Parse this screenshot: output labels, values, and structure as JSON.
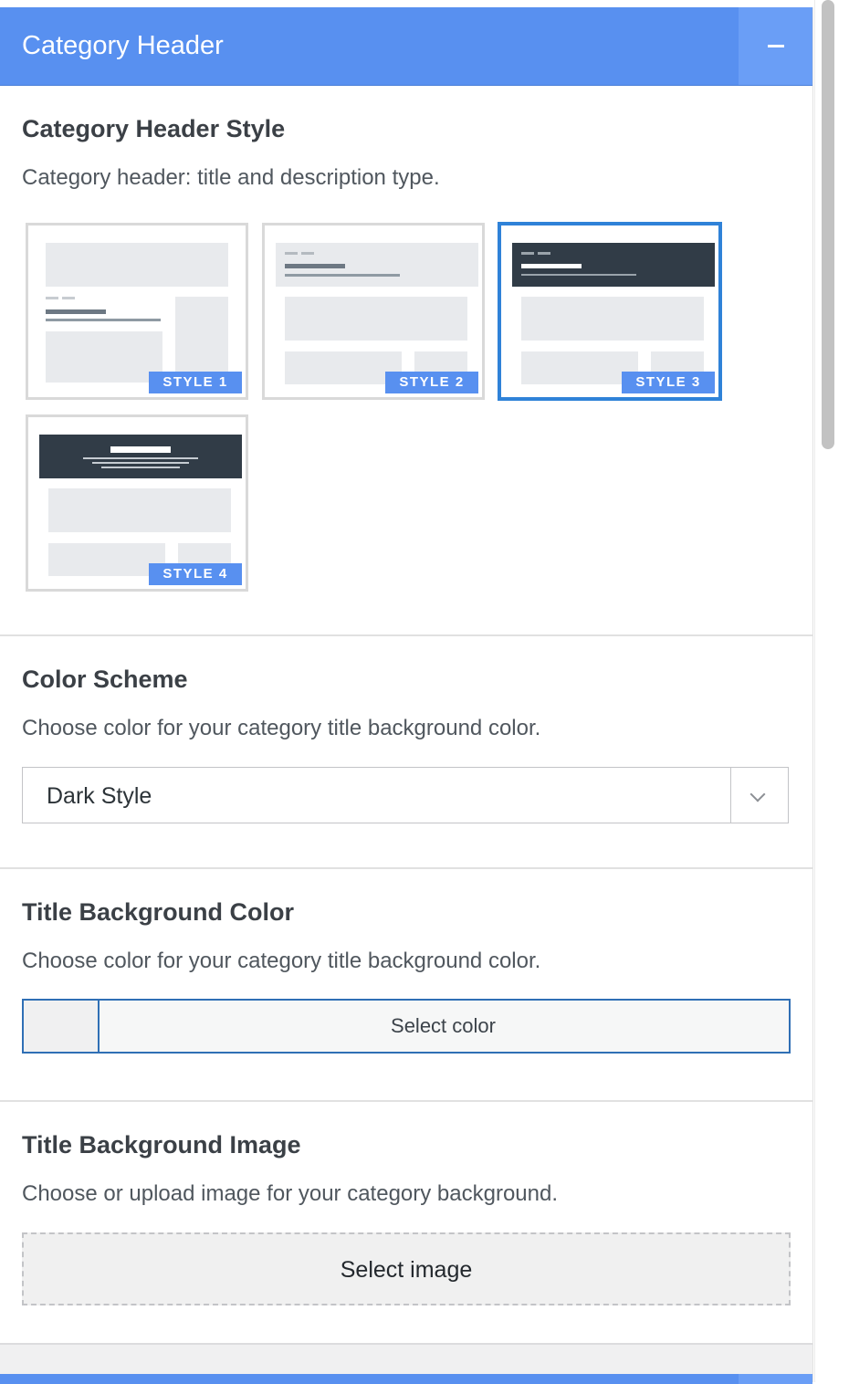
{
  "panel": {
    "title": "Category Header",
    "collapse_icon": "minus-icon"
  },
  "header_style": {
    "title": "Category Header Style",
    "description": "Category header: title and description type.",
    "options": [
      {
        "label": "STYLE 1",
        "selected": false
      },
      {
        "label": "STYLE 2",
        "selected": false
      },
      {
        "label": "STYLE 3",
        "selected": true
      },
      {
        "label": "STYLE 4",
        "selected": false
      }
    ]
  },
  "color_scheme": {
    "title": "Color Scheme",
    "description": "Choose color for your category title background color.",
    "selected": "Dark Style",
    "arrow_icon": "chevron-down-icon"
  },
  "title_bg_color": {
    "title": "Title Background Color",
    "description": "Choose color for your category title background color.",
    "button_label": "Select color"
  },
  "title_bg_image": {
    "title": "Title Background Image",
    "description": "Choose or upload image for your category background.",
    "button_label": "Select image"
  },
  "colors": {
    "accent": "#5890f0",
    "selected_border": "#2f82d8",
    "dark_header": "#313c47"
  }
}
